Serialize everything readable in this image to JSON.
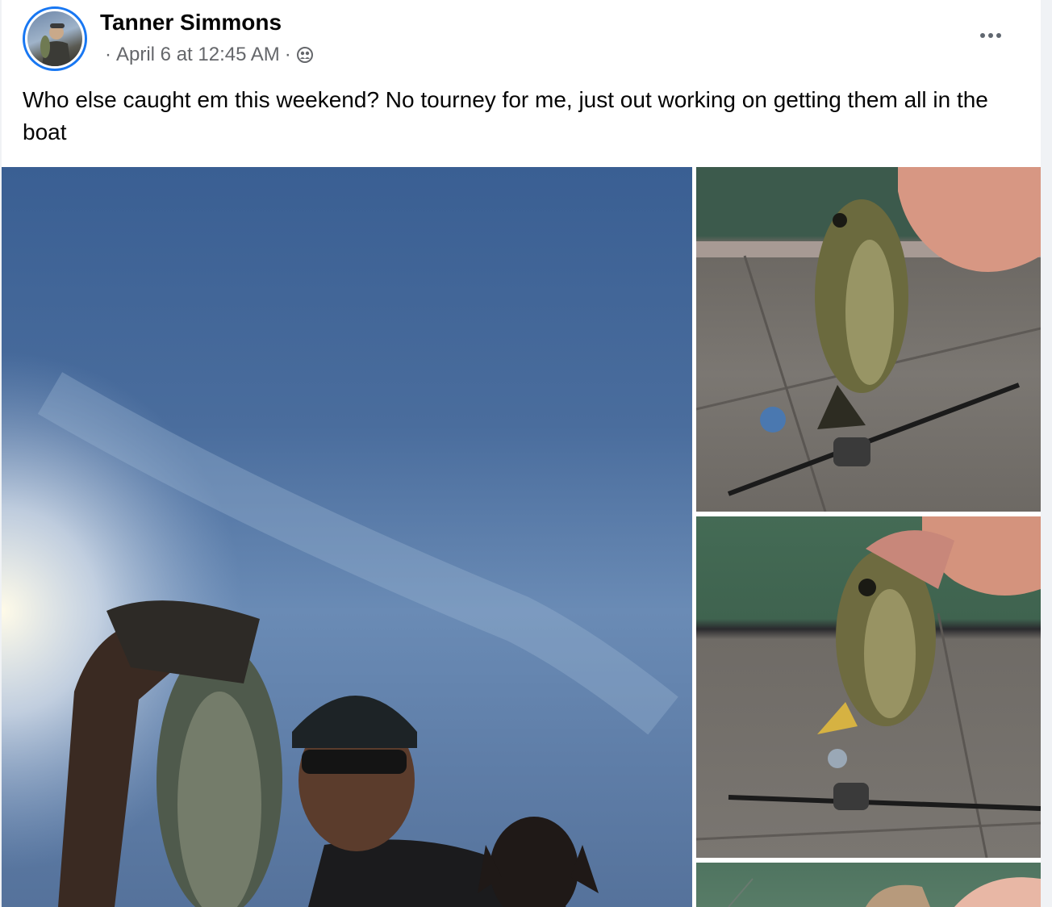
{
  "post": {
    "author": "Tanner Simmons",
    "timestamp": "April 6 at 12:45 AM",
    "separator": "·",
    "audience_icon": "friends-icon",
    "more_icon": "more-options-icon",
    "text": "Who else caught em this weekend? No tourney for me, just out working on getting them all in the boat"
  },
  "colors": {
    "avatar_ring": "#1877f2",
    "author_text": "#050505",
    "meta_text": "#65676b"
  },
  "photos": [
    {
      "name": "photo-main",
      "description_icon": "angler-with-bass-and-dog-photo"
    },
    {
      "name": "photo-2",
      "description_icon": "bass-over-boat-deck-photo"
    },
    {
      "name": "photo-3",
      "description_icon": "bass-over-boat-deck-photo"
    },
    {
      "name": "photo-4",
      "description_icon": "bass-over-water-photo"
    }
  ]
}
